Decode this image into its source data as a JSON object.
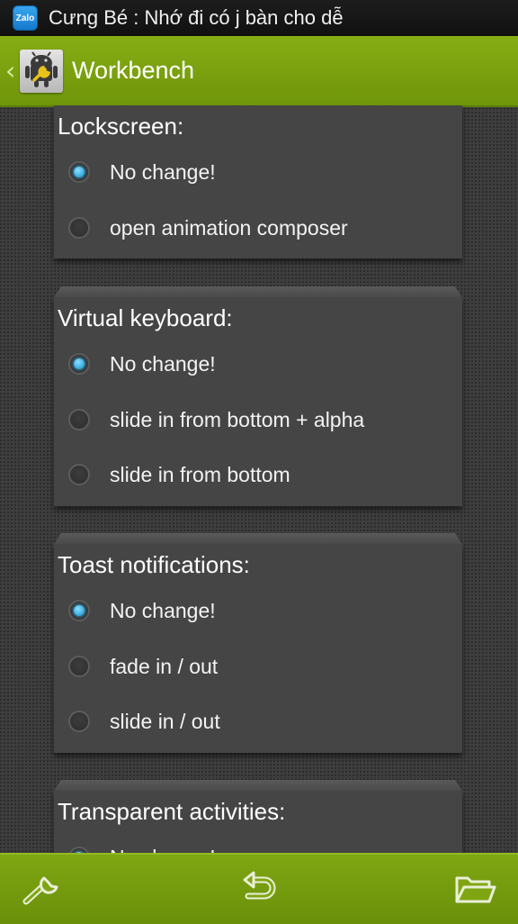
{
  "status_bar": {
    "notification_icon": "zalo-icon",
    "notification_icon_text": "Zalo",
    "notification_text": "Cưng Bé : Nhớ đi có j bàn cho dễ"
  },
  "action_bar": {
    "back_icon": "chevron-left-icon",
    "app_icon": "android-wrench-icon",
    "title": "Workbench"
  },
  "sections": [
    {
      "title": "Lockscreen:",
      "options": [
        {
          "label": "No change!",
          "selected": true
        },
        {
          "label": "open animation composer",
          "selected": false
        }
      ]
    },
    {
      "title": "Virtual keyboard:",
      "options": [
        {
          "label": "No change!",
          "selected": true
        },
        {
          "label": "slide in from bottom + alpha",
          "selected": false
        },
        {
          "label": "slide in from bottom",
          "selected": false
        }
      ]
    },
    {
      "title": "Toast notifications:",
      "options": [
        {
          "label": "No change!",
          "selected": true
        },
        {
          "label": "fade in / out",
          "selected": false
        },
        {
          "label": "slide in / out",
          "selected": false
        }
      ]
    },
    {
      "title": "Transparent activities:",
      "options": [
        {
          "label": "No change!",
          "selected": true
        }
      ]
    }
  ],
  "bottom_bar": {
    "left_icon": "wrench-icon",
    "center_icon": "undo-icon",
    "right_icon": "folder-open-icon"
  },
  "colors": {
    "accent_green": "#7ba20f",
    "radio_selected": "#39b6ee",
    "card_bg": "#454545"
  }
}
